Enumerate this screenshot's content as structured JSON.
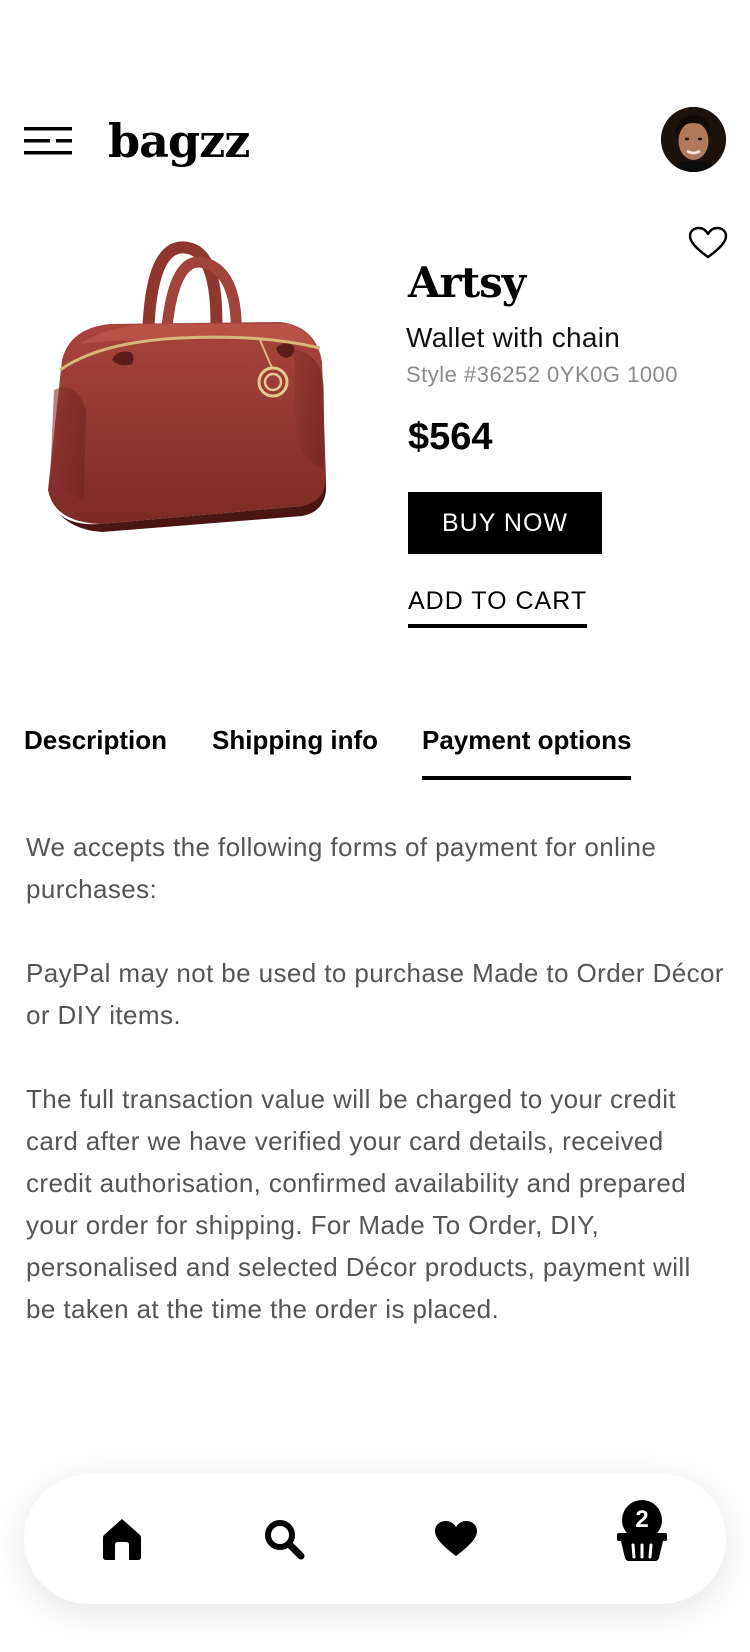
{
  "header": {
    "logo": "bagzz",
    "menu_icon": "menu-icon",
    "avatar_icon": "user-avatar"
  },
  "product": {
    "name": "Artsy",
    "subtitle": "Wallet with chain",
    "style": "Style #36252 0YK0G 1000",
    "price": "$564",
    "buy_now_label": "BUY NOW",
    "add_to_cart_label": "ADD TO CART",
    "image_icon": "handbag-image",
    "color": "#9b3a34"
  },
  "tabs": [
    {
      "label": "Description",
      "active": false
    },
    {
      "label": "Shipping info",
      "active": false
    },
    {
      "label": "Payment options",
      "active": true
    }
  ],
  "content": {
    "paragraphs": [
      "We accepts the following forms of payment for online purchases:",
      "PayPal may not be used to purchase Made to Order Décor or DIY items.",
      "The full transaction value will be charged to your credit card after we have verified your card details, received credit authorisation, confirmed availability and prepared your order for shipping. For Made To Order, DIY, personalised and selected Décor products, payment will be taken at the time the order is placed."
    ]
  },
  "bottom_nav": {
    "items": [
      {
        "icon": "home-icon"
      },
      {
        "icon": "search-icon"
      },
      {
        "icon": "heart-icon"
      },
      {
        "icon": "basket-icon"
      }
    ],
    "cart_count": "2"
  }
}
